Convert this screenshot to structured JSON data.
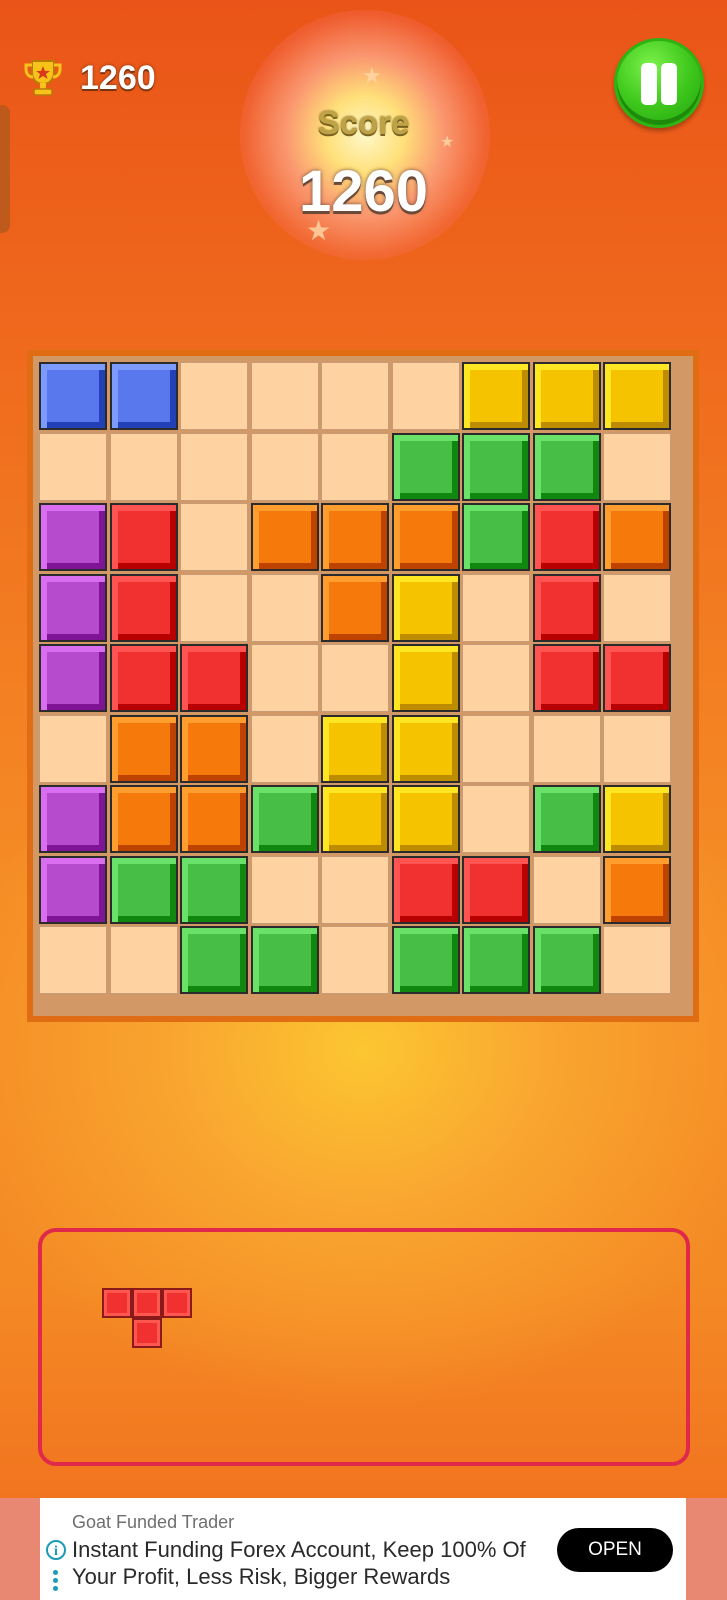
{
  "header": {
    "best_score": "1260",
    "score_label": "Score",
    "score_value": "1260",
    "best_icon": "trophy-icon",
    "pause_icon": "pause-icon"
  },
  "colors": {
    "B": "#5a78ee",
    "Y": "#f5c300",
    "G": "#47bf46",
    "P": "#b64bce",
    "R": "#f0312f",
    "O": "#f57a0b",
    "empty": "#ffd2a2"
  },
  "board": {
    "size": 9,
    "rows": [
      [
        "B",
        "B",
        ".",
        ".",
        ".",
        ".",
        "Y",
        "Y",
        "Y"
      ],
      [
        ".",
        ".",
        ".",
        ".",
        ".",
        "G",
        "G",
        "G",
        "."
      ],
      [
        "P",
        "R",
        ".",
        "O",
        "O",
        "O",
        "G",
        "R",
        "O"
      ],
      [
        "P",
        "R",
        ".",
        ".",
        "O",
        "Y",
        ".",
        "R",
        "."
      ],
      [
        "P",
        "R",
        "R",
        ".",
        ".",
        "Y",
        ".",
        "R",
        "R"
      ],
      [
        ".",
        "O",
        "O",
        ".",
        "Y",
        "Y",
        ".",
        ".",
        "."
      ],
      [
        "P",
        "O",
        "O",
        "G",
        "Y",
        "Y",
        ".",
        "G",
        "Y"
      ],
      [
        "P",
        "G",
        "G",
        ".",
        ".",
        "R",
        "R",
        ".",
        "O"
      ],
      [
        ".",
        ".",
        "G",
        "G",
        ".",
        "G",
        "G",
        "G",
        "."
      ]
    ]
  },
  "tray": {
    "pieces": [
      {
        "color": "R",
        "shape": [
          [
            1,
            1,
            1
          ],
          [
            0,
            1,
            0
          ]
        ]
      }
    ]
  },
  "ad": {
    "brand": "Goat Funded Trader",
    "text": "Instant Funding Forex Account, Keep 100% Of Your Profit, Less Risk, Bigger Rewards",
    "button": "OPEN",
    "info_icon": "info-icon"
  }
}
